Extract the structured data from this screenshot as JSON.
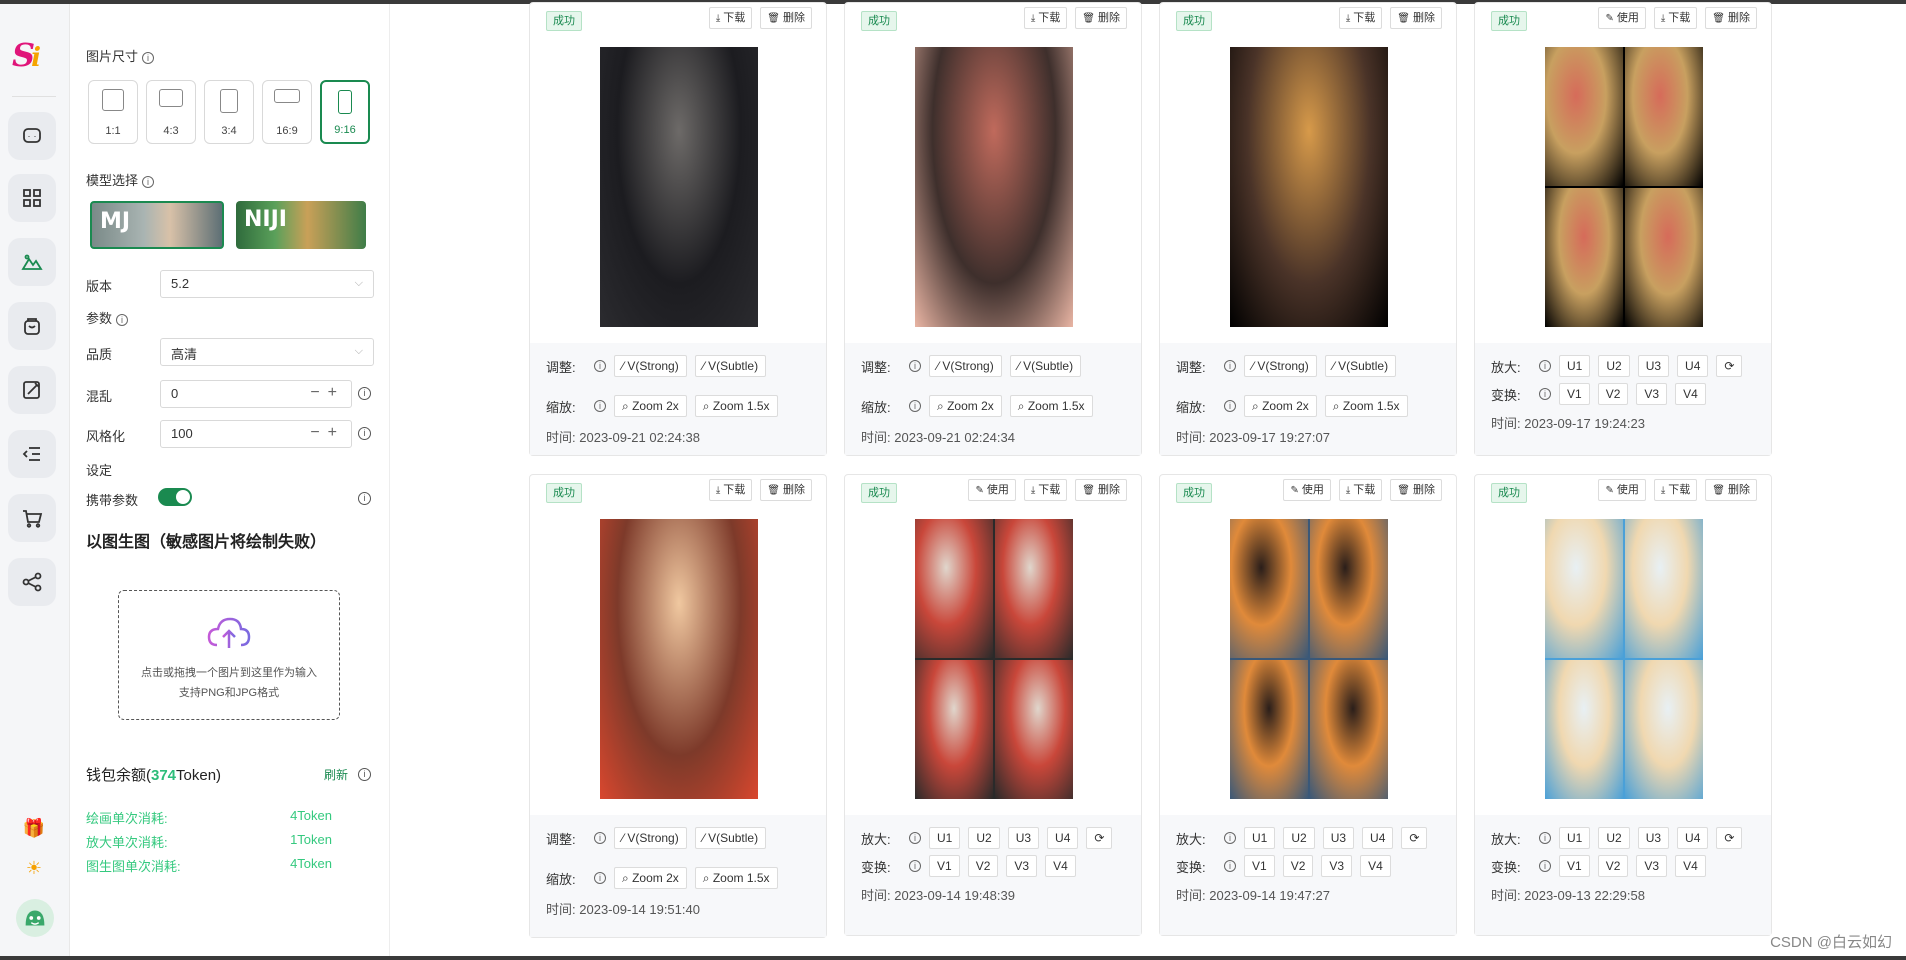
{
  "sidebar": {
    "logo_text": "Si",
    "nav_icons": [
      "chat-icon",
      "grid-icon",
      "image-icon",
      "bag-icon",
      "edit-image-icon",
      "list-indent-icon",
      "cart-icon",
      "share-icon"
    ],
    "bottom_icons": [
      "gift-icon",
      "sun-icon",
      "avatar"
    ]
  },
  "settings": {
    "size_label": "图片尺寸",
    "sizes": [
      "1:1",
      "4:3",
      "3:4",
      "16:9",
      "9:16"
    ],
    "size_selected": "9:16",
    "model_label": "模型选择",
    "models": [
      "MJ",
      "NIJI"
    ],
    "model_selected": "MJ",
    "version_label": "版本",
    "version_value": "5.2",
    "params_label": "参数",
    "quality_label": "品质",
    "quality_value": "高清",
    "chaos_label": "混乱",
    "chaos_value": "0",
    "stylize_label": "风格化",
    "stylize_value": "100",
    "setting_label": "设定",
    "carry_params_label": "携带参数",
    "carry_params_on": true,
    "img2img_title": "以图生图（敏感图片将绘制失败）",
    "upload_line1": "点击或拖拽一个图片到这里作为输入",
    "upload_line2": "支持PNG和JPG格式",
    "wallet_prefix": "钱包余额(",
    "wallet_amount": "374",
    "wallet_suffix": "Token)",
    "refresh_label": "刷新",
    "costs": [
      {
        "label": "绘画单次消耗:",
        "value": "4Token"
      },
      {
        "label": "放大单次消耗:",
        "value": "1Token"
      },
      {
        "label": "图生图单次消耗:",
        "value": "4Token"
      }
    ]
  },
  "common": {
    "status": "成功",
    "download": "下载",
    "delete": "删除",
    "use": "使用",
    "adjust": "调整:",
    "zoom": "缩放:",
    "upscale": "放大:",
    "variation": "变换:",
    "v_strong": "V(Strong)",
    "v_subtle": "V(Subtle)",
    "zoom2x": "Zoom 2x",
    "zoom15x": "Zoom 1.5x",
    "u_buttons": [
      "U1",
      "U2",
      "U3",
      "U4"
    ],
    "v_buttons": [
      "V1",
      "V2",
      "V3",
      "V4"
    ],
    "time_prefix": "时间:"
  },
  "cards": [
    {
      "time": "2023-09-21 02:24:38",
      "kind": "single",
      "palette": [
        "#2b2b2f",
        "#6d6a68",
        "#1c1c20"
      ]
    },
    {
      "time": "2023-09-21 02:24:34",
      "kind": "single",
      "palette": [
        "#e9b5a4",
        "#c06a5c",
        "#3e2f2c"
      ]
    },
    {
      "time": "2023-09-17 19:27:07",
      "kind": "single",
      "palette": [
        "#000000",
        "#d79a4a",
        "#4a3328"
      ]
    },
    {
      "time": "2023-09-17 19:24:23",
      "kind": "grid",
      "palette": [
        "#000000",
        "#c8a060",
        "#d66b5a"
      ]
    },
    {
      "time": "2023-09-14 19:51:40",
      "kind": "single",
      "palette": [
        "#d9472e",
        "#f0c8a0",
        "#7d3a2a"
      ]
    },
    {
      "time": "2023-09-14 19:48:39",
      "kind": "grid",
      "palette": [
        "#2a2a2a",
        "#c9473a",
        "#e0d6cc"
      ]
    },
    {
      "time": "2023-09-14 19:47:27",
      "kind": "grid",
      "palette": [
        "#3a5878",
        "#e08a3a",
        "#2a1e1a"
      ]
    },
    {
      "time": "2023-09-13 22:29:58",
      "kind": "grid",
      "palette": [
        "#4aa0d8",
        "#f0d8b0",
        "#e8f0f4"
      ]
    }
  ],
  "watermark": "CSDN @白云如幻"
}
